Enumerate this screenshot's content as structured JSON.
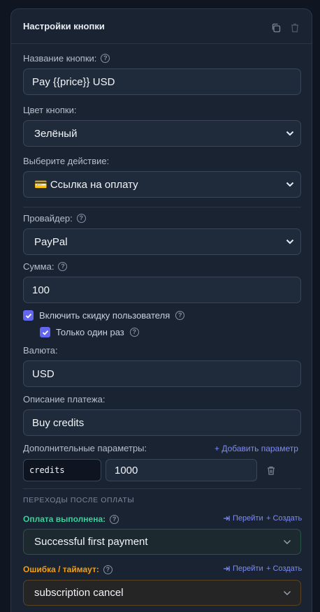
{
  "panel": {
    "title": "Настройки кнопки"
  },
  "header_icons": [
    "copy-icon",
    "delete-icon"
  ],
  "button_name": {
    "label": "Название кнопки:",
    "value": "Pay {{price}} USD"
  },
  "button_color": {
    "label": "Цвет кнопки:",
    "value": "Зелёный"
  },
  "action": {
    "label": "Выберите действие:",
    "value": "💳 Ссылка на оплату"
  },
  "provider": {
    "label": "Провайдер:",
    "value": "PayPal"
  },
  "amount": {
    "label": "Сумма:",
    "value": "100"
  },
  "discount": {
    "label": "Включить скидку пользователя",
    "checked": true
  },
  "once": {
    "label": "Только один раз",
    "checked": true
  },
  "currency": {
    "label": "Валюта:",
    "value": "USD"
  },
  "description": {
    "label": "Описание платежа:",
    "value": "Buy credits"
  },
  "params": {
    "label": "Дополнительные параметры:",
    "add_label": "+ Добавить параметр",
    "rows": [
      {
        "key": "credits",
        "value": "1000"
      }
    ]
  },
  "transitions": {
    "title": "ПЕРЕХОДЫ ПОСЛЕ ОПЛАТЫ",
    "success": {
      "label": "Оплата выполнена:",
      "value": "Successful first payment",
      "color": "#34d399"
    },
    "error": {
      "label": "Ошибка / таймаут:",
      "value": "subscription cancel",
      "color": "#f59e0b"
    },
    "go_label": "Перейти",
    "create_label": "+ Создать"
  },
  "colors": {
    "accent": "#6366f1",
    "link": "#7e8cf5",
    "background": "#1a2331"
  }
}
